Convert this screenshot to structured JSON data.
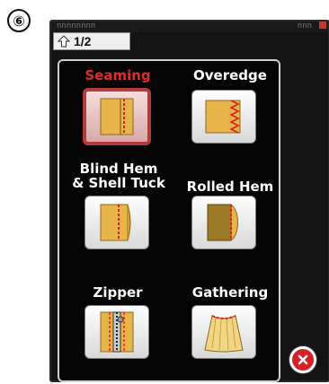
{
  "figure": {
    "step_marker": "⑥"
  },
  "status_bar": {
    "left_text": "nnnnnnnn",
    "right_text": "nnn"
  },
  "nav": {
    "page_indicator": "1/2"
  },
  "stitches": [
    {
      "label": "Seaming",
      "icon": "seaming-icon",
      "selected": true
    },
    {
      "label": "Overedge",
      "icon": "overedge-icon",
      "selected": false
    },
    {
      "label": "Blind Hem\n& Shell Tuck",
      "icon": "blind-hem-icon",
      "selected": false
    },
    {
      "label": "Rolled Hem",
      "icon": "rolled-hem-icon",
      "selected": false
    },
    {
      "label": "Zipper",
      "icon": "zipper-icon",
      "selected": false
    },
    {
      "label": "Gathering",
      "icon": "gathering-icon",
      "selected": false
    }
  ],
  "colors": {
    "selected_label": "#e12a2a",
    "fabric": "#e8b54a",
    "stitch_line": "#e02020",
    "close_button": "#d81f27"
  },
  "close_button": {
    "icon": "close-icon"
  }
}
